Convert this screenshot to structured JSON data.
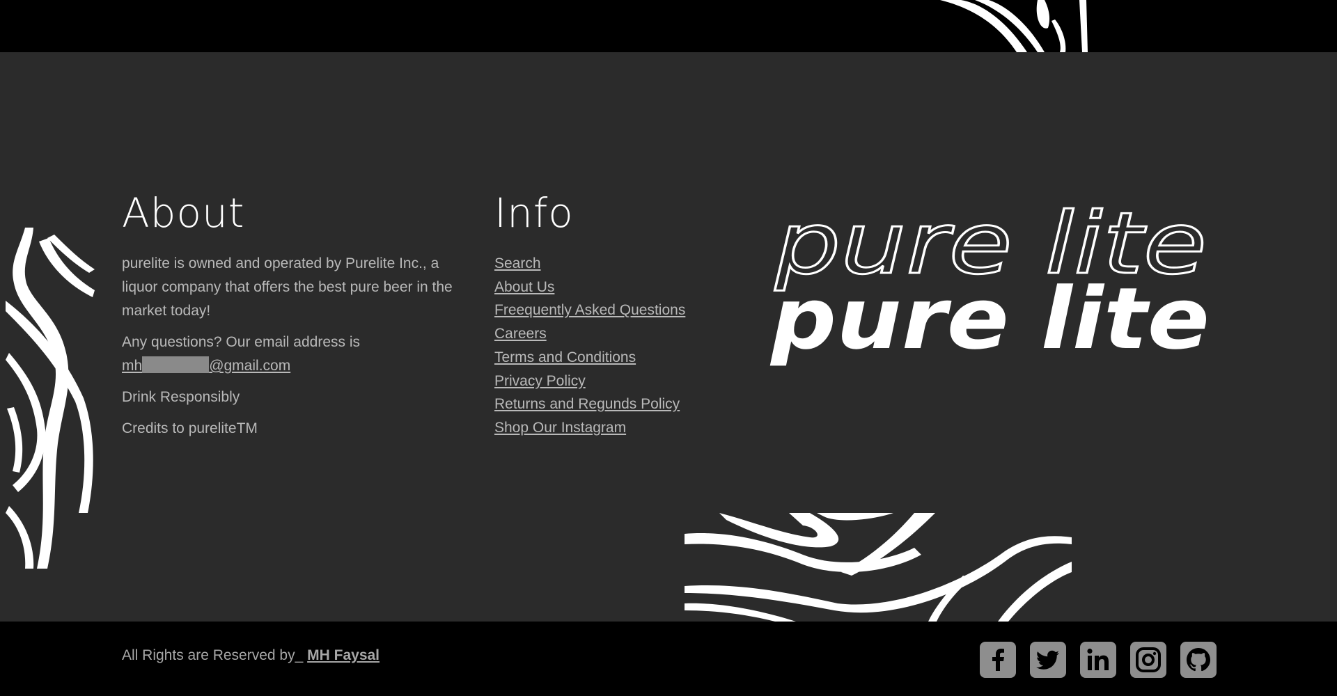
{
  "about": {
    "heading": "About",
    "description": "purelite is owned and operated by Purelite Inc., a liquor company that offers the best pure beer in the market today!",
    "contact_prefix": "Any questions? Our email address is",
    "email_start": "mh",
    "email_end": "@gmail.com",
    "drink_note": "Drink Responsibly",
    "credits": "Credits to pureliteTM"
  },
  "info": {
    "heading": "Info",
    "links": [
      "Search",
      "About Us",
      "Freequently Asked Questions",
      "Careers",
      "Terms and Conditions",
      "Privacy Policy",
      "Returns and Regunds Policy",
      "Shop Our Instagram"
    ]
  },
  "logo": {
    "outline_text": "pure lite",
    "filled_text": "pure lite"
  },
  "footer": {
    "rights_text": "All Rights are Reserved by_",
    "author": "MH Faysal"
  },
  "social": {
    "icons": [
      "facebook-icon",
      "twitter-icon",
      "linkedin-icon",
      "instagram-icon",
      "github-icon"
    ]
  },
  "colors": {
    "background": "#2b2b2b",
    "band": "#000000",
    "text": "#b9b9b9",
    "heading": "#ffffff",
    "icon_bg": "#8e8e8e"
  }
}
